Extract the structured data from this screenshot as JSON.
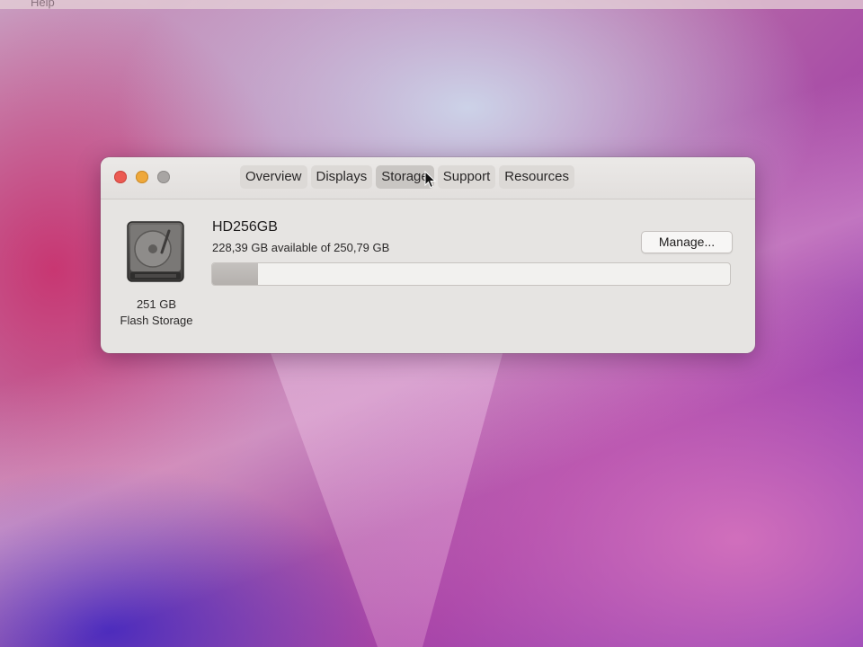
{
  "menubar": {
    "partial_item": "Help"
  },
  "window": {
    "traffic_lights": [
      "close",
      "minimize",
      "zoom"
    ],
    "tabs": [
      {
        "label": "Overview",
        "selected": false
      },
      {
        "label": "Displays",
        "selected": false
      },
      {
        "label": "Storage",
        "selected": true
      },
      {
        "label": "Support",
        "selected": false
      },
      {
        "label": "Resources",
        "selected": false
      }
    ]
  },
  "storage": {
    "disk_icon": "hard-drive-icon",
    "disk_size": "251 GB",
    "disk_type": "Flash Storage",
    "volume_name": "HD256GB",
    "availability": "228,39 GB available of 250,79 GB",
    "used_fraction": 0.0893,
    "manage_label": "Manage..."
  },
  "colors": {
    "close": "#ec5a52",
    "minimize": "#efa83a",
    "zoom": "#a8a5a3"
  }
}
